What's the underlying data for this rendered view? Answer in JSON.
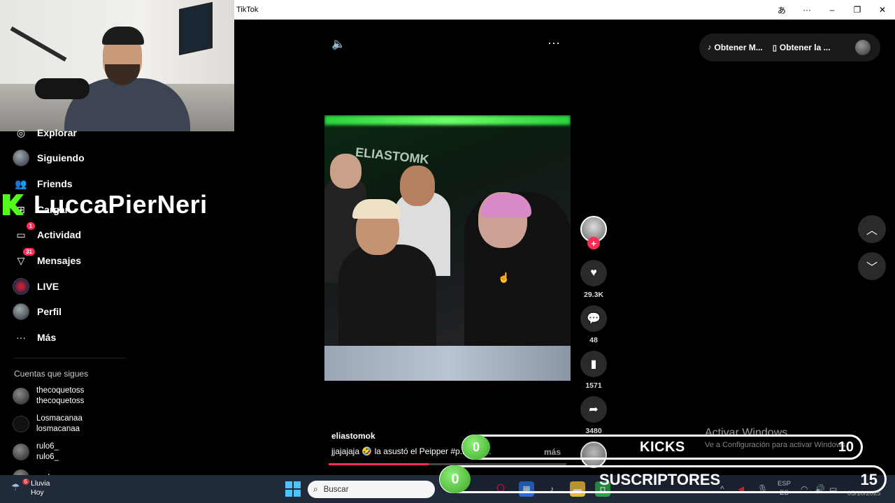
{
  "window": {
    "title": "TikTok",
    "controls": [
      "あ",
      "···",
      "–",
      "❐",
      "✕"
    ]
  },
  "overlay": {
    "streamer": "LuccaPierNeri"
  },
  "sidebar": {
    "items": [
      {
        "label": "Explorar",
        "icon": "compass-icon"
      },
      {
        "label": "Siguiendo",
        "icon": "avatar"
      },
      {
        "label": "Friends",
        "icon": "friends-icon"
      },
      {
        "label": "Cargar",
        "icon": "upload-icon"
      },
      {
        "label": "Actividad",
        "icon": "inbox-icon",
        "badge": "1"
      },
      {
        "label": "Mensajes",
        "icon": "send-icon",
        "badge": "31"
      },
      {
        "label": "LIVE",
        "icon": "live-icon"
      },
      {
        "label": "Perfil",
        "icon": "avatar"
      },
      {
        "label": "Más",
        "icon": "more-icon"
      }
    ],
    "following_title": "Cuentas que sigues",
    "following": [
      {
        "name": "thecoquetoss",
        "handle": "thecoquetoss"
      },
      {
        "name": "Losmacanaa",
        "handle": "losmacanaa"
      },
      {
        "name": "rulo6_",
        "handle": "rulo6_"
      },
      {
        "name": "godemax",
        "handle": ""
      }
    ]
  },
  "player": {
    "get_buttons": [
      "Obtener M...",
      "Obtener la ..."
    ],
    "author": "eliastomok",
    "caption": "jjajajaja 🤣 la asustó el Peipper  #p... clip  ...",
    "caption_more": "más",
    "progress": 0.42,
    "likes": "29.3K",
    "comments": "48",
    "saves": "1571",
    "shares": "3480",
    "video_logo": "ELIASTOMK"
  },
  "watermark": {
    "line1": "Activar Windows",
    "line2": "Ve a Configuración para activar Windows."
  },
  "stream_counters": {
    "kicks": {
      "left": "0",
      "label": "KICKS",
      "right": "10"
    },
    "subs": {
      "left": "0",
      "label": "SUSCRIPTORES",
      "right": "15"
    }
  },
  "taskbar": {
    "weather_label": "Lluvia",
    "weather_sub": "Hoy",
    "weather_badge": "6",
    "search_placeholder": "Buscar",
    "lang_top": "ESP",
    "lang_bottom": "ES",
    "time": "",
    "date": "05/10/2025"
  },
  "colors": {
    "accent": "#fe2c55",
    "kick_green": "#53fc18",
    "taskbar": "#202a3a"
  }
}
